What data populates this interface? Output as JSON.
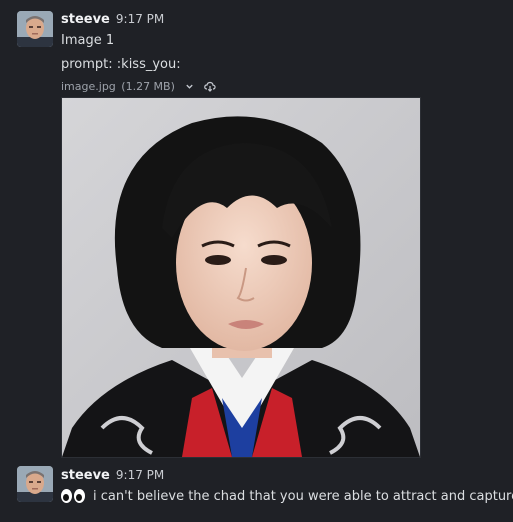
{
  "messages": [
    {
      "username": "steeve",
      "time": "9:17 PM",
      "text": "Image 1",
      "prompt": "prompt: :kiss_you:",
      "attachment": {
        "filename": "image.jpg",
        "size": "(1.27 MB)",
        "icons": [
          "chevron-down-icon",
          "download-icon"
        ]
      }
    },
    {
      "username": "steeve",
      "time": "9:17 PM",
      "emoji": "eyes-emoji",
      "text": "i can't believe the chad that you were able to attract and capture"
    }
  ]
}
